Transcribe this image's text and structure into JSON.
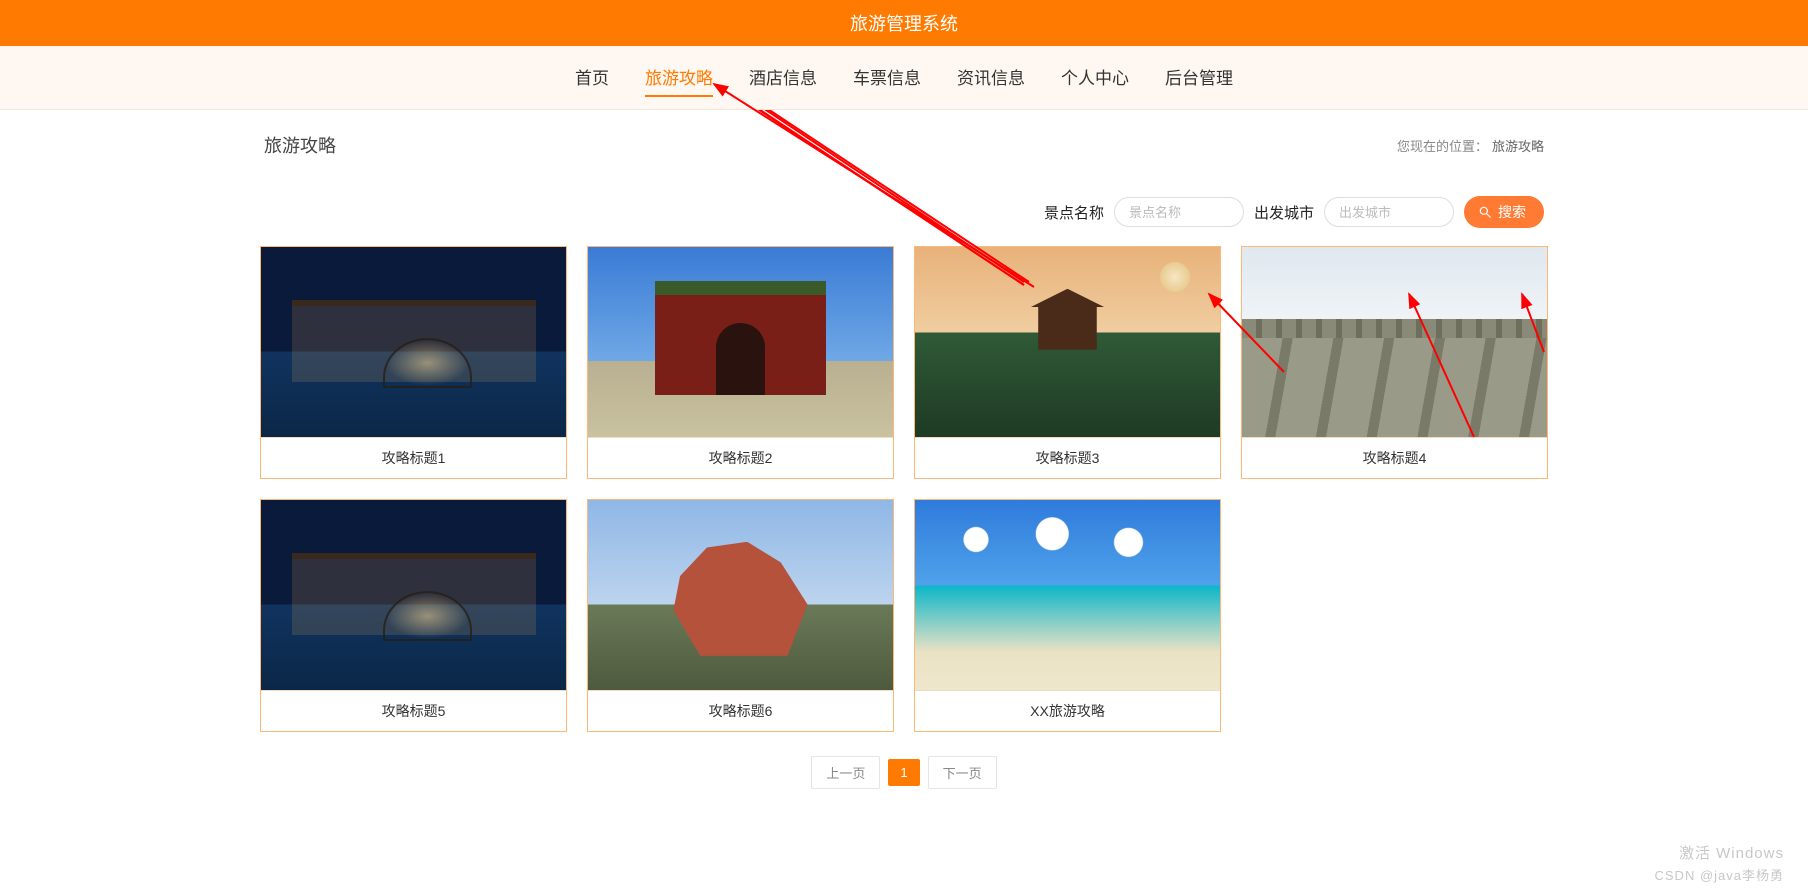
{
  "header": {
    "title": "旅游管理系统"
  },
  "nav": {
    "items": [
      {
        "label": "首页"
      },
      {
        "label": "旅游攻略",
        "active": true
      },
      {
        "label": "酒店信息"
      },
      {
        "label": "车票信息"
      },
      {
        "label": "资讯信息"
      },
      {
        "label": "个人中心"
      },
      {
        "label": "后台管理"
      }
    ]
  },
  "crumb": {
    "title": "旅游攻略",
    "location_label": "您现在的位置：",
    "location_value": "旅游攻略"
  },
  "search": {
    "field1_label": "景点名称",
    "field1_placeholder": "景点名称",
    "field2_label": "出发城市",
    "field2_placeholder": "出发城市",
    "button_label": "搜索"
  },
  "cards": [
    {
      "title": "攻略标题1",
      "scene": "water-town"
    },
    {
      "title": "攻略标题2",
      "scene": "gate"
    },
    {
      "title": "攻略标题3",
      "scene": "temple"
    },
    {
      "title": "攻略标题4",
      "scene": "wall"
    },
    {
      "title": "攻略标题5",
      "scene": "water-town"
    },
    {
      "title": "攻略标题6",
      "scene": "rock"
    },
    {
      "title": "XX旅游攻略",
      "scene": "beach"
    }
  ],
  "pager": {
    "prev": "上一页",
    "current": "1",
    "next": "下一页"
  },
  "watermark": {
    "line1": "激活 Windows",
    "line2": "CSDN @java李杨勇"
  }
}
